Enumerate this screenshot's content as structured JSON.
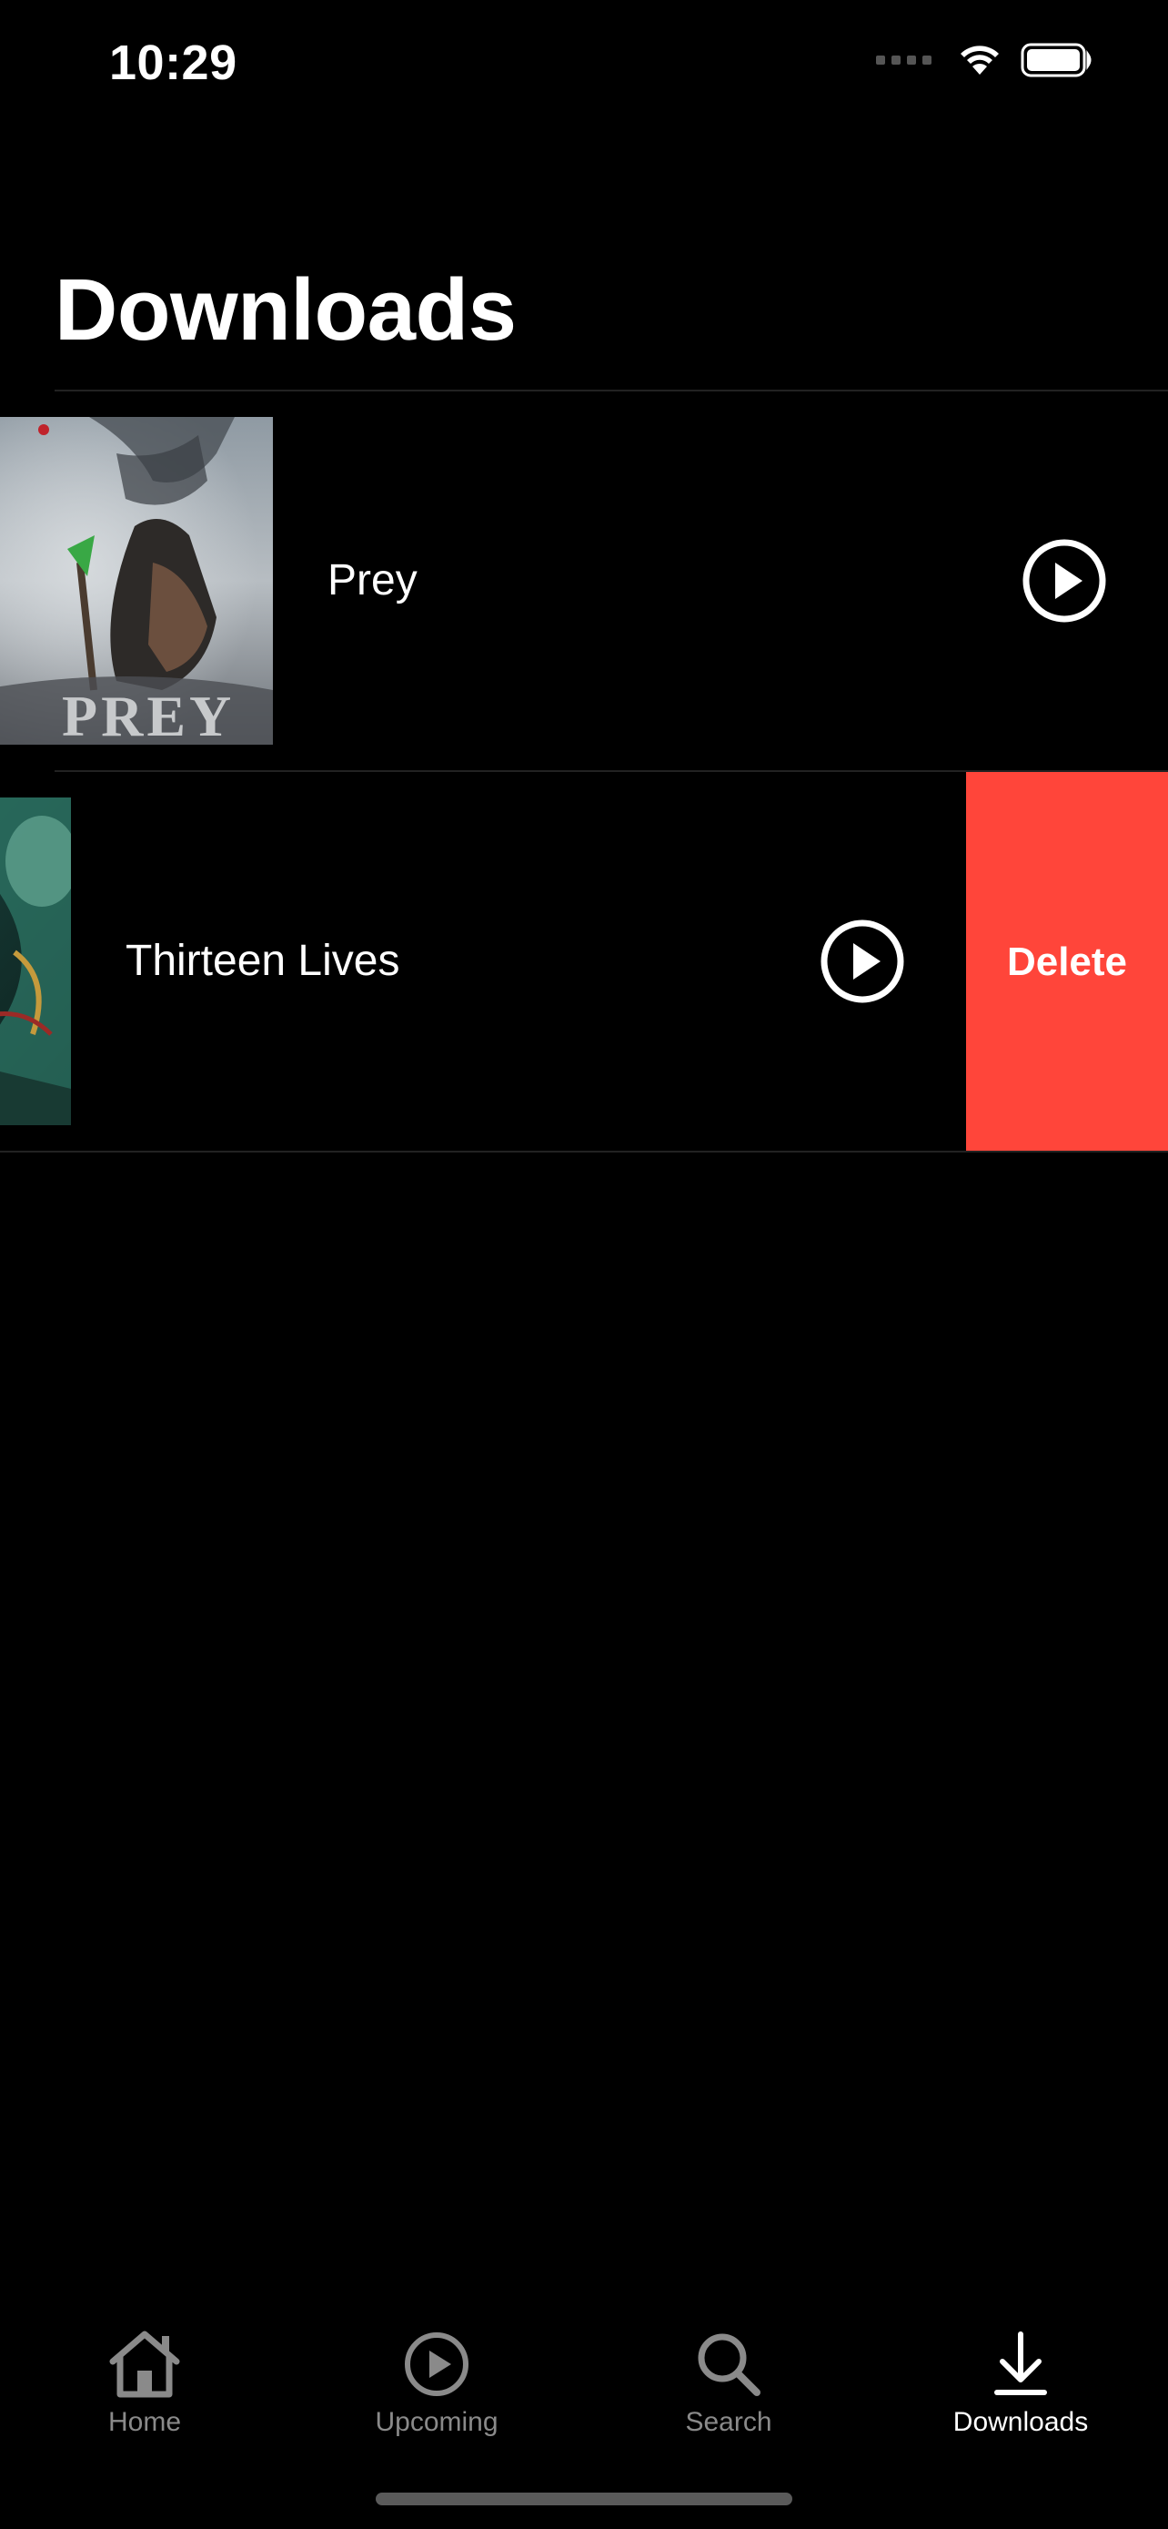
{
  "status_bar": {
    "time": "10:29"
  },
  "page": {
    "title": "Downloads"
  },
  "downloads": [
    {
      "title": "Prey",
      "poster_text": "PREY",
      "swiped_open": false
    },
    {
      "title": "Thirteen Lives",
      "swiped_open": true,
      "delete_label": "Delete"
    }
  ],
  "tab_bar": {
    "items": [
      {
        "label": "Home",
        "icon": "house-icon",
        "active": false
      },
      {
        "label": "Upcoming",
        "icon": "play-circle-icon",
        "active": false
      },
      {
        "label": "Search",
        "icon": "magnifying-glass-icon",
        "active": false
      },
      {
        "label": "Downloads",
        "icon": "download-arrow-icon",
        "active": true
      }
    ]
  },
  "colors": {
    "background": "#000000",
    "delete": "#ff453a",
    "inactive_tab": "#8a8a8a",
    "active_tab": "#ffffff"
  }
}
